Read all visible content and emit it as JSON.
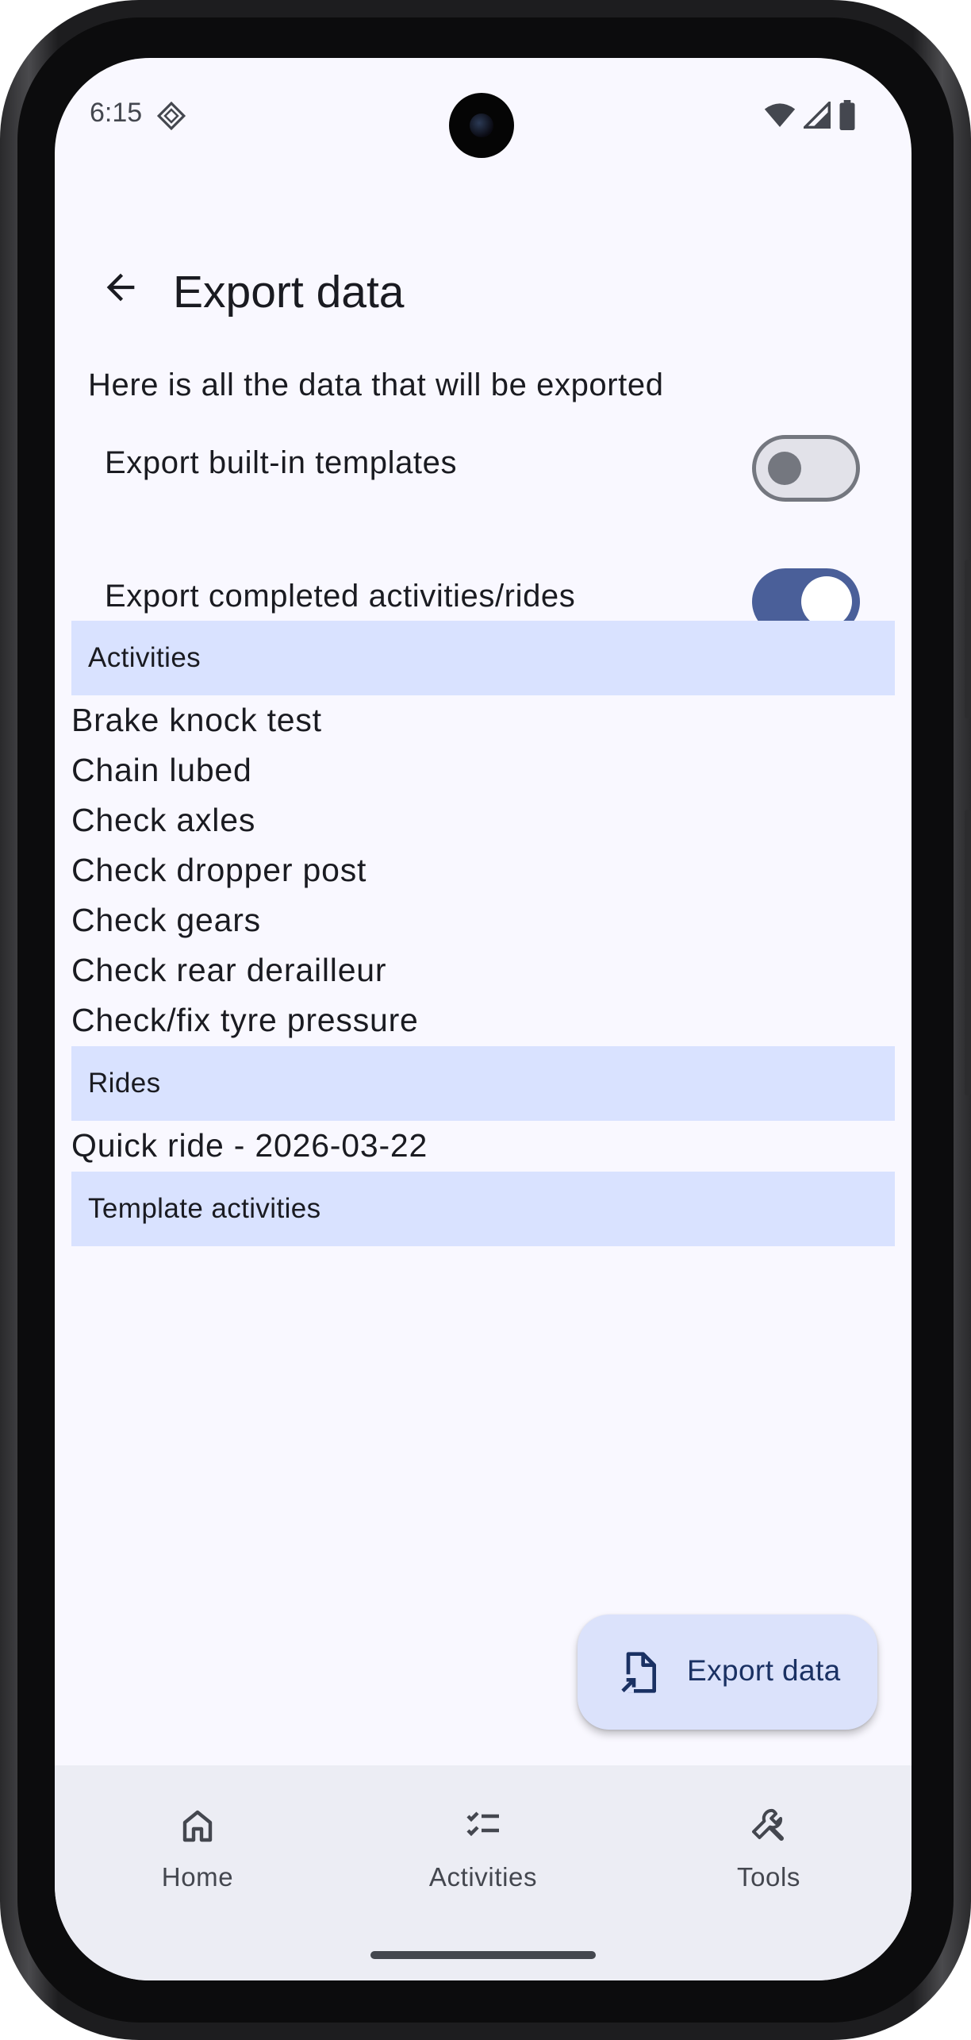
{
  "status_bar": {
    "time": "6:15"
  },
  "header": {
    "title": "Export data"
  },
  "intro_text": "Here is all the data that will be exported",
  "toggles": [
    {
      "label": "Export built-in templates",
      "on": false
    },
    {
      "label": "Export completed activities/rides",
      "on": true
    }
  ],
  "sections": {
    "activities": {
      "title": "Activities",
      "items": [
        "Brake knock test",
        "Chain lubed",
        "Check axles",
        "Check dropper post",
        "Check gears",
        "Check rear derailleur",
        "Check/fix tyre pressure"
      ]
    },
    "rides": {
      "title": "Rides",
      "items": [
        "Quick ride - 2026-03-22"
      ]
    },
    "templates": {
      "title": "Template activities",
      "items": []
    }
  },
  "fab": {
    "label": "Export data",
    "icon": "file-export-icon"
  },
  "bottom_nav": [
    {
      "label": "Home",
      "icon": "home-icon"
    },
    {
      "label": "Activities",
      "icon": "checklist-icon"
    },
    {
      "label": "Tools",
      "icon": "wrench-icon"
    }
  ],
  "colors": {
    "accent": "#4a5f99",
    "section_header_bg": "#d9e2ff",
    "fab_bg": "#dbe2fb",
    "screen_bg": "#f9f8ff",
    "nav_bg": "#ecedf4"
  }
}
